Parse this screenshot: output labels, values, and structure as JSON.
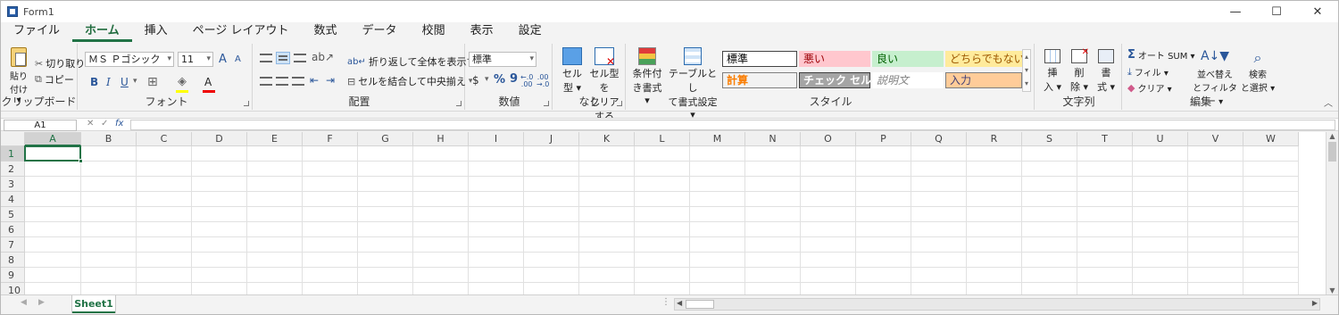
{
  "window": {
    "title": "Form1",
    "minimize": "—",
    "maximize": "☐",
    "close": "✕"
  },
  "tabs": [
    "ファイル",
    "ホーム",
    "挿入",
    "ページ レイアウト",
    "数式",
    "データ",
    "校閲",
    "表示",
    "設定"
  ],
  "active_tab": 1,
  "clipboard": {
    "paste": "貼り",
    "paste2": "付け ▾",
    "cut": "切り取り",
    "copy": "コピー",
    "label": "クリップボード"
  },
  "font": {
    "name": "ＭＳ Ｐゴシック",
    "size": "11",
    "grow": "A",
    "shrink": "A",
    "bold": "B",
    "italic": "I",
    "underline": "U",
    "color_letter": "A",
    "label": "フォント"
  },
  "alignment": {
    "wrap": "折り返して全体を表示する",
    "merge": "セルを結合して中央揃え",
    "label": "配置"
  },
  "number": {
    "format": "標準",
    "currency": "$",
    "percent": "%",
    "comma": "9",
    "inc": "←.0\n.00",
    "dec": ".00\n→.0",
    "label": "数値"
  },
  "cell_type": {
    "btn1a": "セル",
    "btn1b": "型 ▾",
    "btn2a": "セル型を",
    "btn2b": "クリアする",
    "label": "なし"
  },
  "styles_group": {
    "cond1": "条件付",
    "cond2": "き書式 ▾",
    "table1": "テーブルとし",
    "table2": "て書式設定 ▾",
    "label": "スタイル",
    "cells": [
      {
        "text": "標準",
        "bg": "#ffffff",
        "fg": "#000000",
        "border": "#444444"
      },
      {
        "text": "悪い",
        "bg": "#ffc7ce",
        "fg": "#9c0006",
        "border": "#ffc7ce"
      },
      {
        "text": "良い",
        "bg": "#c6efce",
        "fg": "#006100",
        "border": "#c6efce"
      },
      {
        "text": "どちらでもない",
        "bg": "#ffeb9c",
        "fg": "#9c5700",
        "border": "#ffeb9c"
      },
      {
        "text": "計算",
        "bg": "#f2f2f2",
        "fg": "#fa7d00",
        "border": "#7f7f7f"
      },
      {
        "text": "チェック セル",
        "bg": "#a5a5a5",
        "fg": "#ffffff",
        "border": "#3f3f3f"
      },
      {
        "text": "説明文",
        "bg": "#ffffff",
        "fg": "#7f7f7f",
        "border": "#ffffff"
      },
      {
        "text": "入力",
        "bg": "#ffcc99",
        "fg": "#3f3f76",
        "border": "#7f7f7f"
      }
    ]
  },
  "cells_group": {
    "insert1": "挿",
    "insert2": "入 ▾",
    "delete1": "削",
    "delete2": "除 ▾",
    "format1": "書",
    "format2": "式 ▾",
    "label": "文字列"
  },
  "editing": {
    "autosum": "オート SUM ▾",
    "fill": "フィル ▾",
    "clear": "クリア ▾",
    "sort1": "並べ替え",
    "sort2": "とフィルター ▾",
    "find1": "検索",
    "find2": "と選択 ▾",
    "label": "編集"
  },
  "formula_bar": {
    "namebox": "A1",
    "fx": "fx",
    "value": ""
  },
  "columns": [
    "A",
    "B",
    "C",
    "D",
    "E",
    "F",
    "G",
    "H",
    "I",
    "J",
    "K",
    "L",
    "M",
    "N",
    "O",
    "P",
    "Q",
    "R",
    "S",
    "T",
    "U",
    "V",
    "W"
  ],
  "rows": [
    "1",
    "2",
    "3",
    "4",
    "5",
    "6",
    "7",
    "8",
    "9",
    "10"
  ],
  "sheet": {
    "name": "Sheet1"
  },
  "accent": "#217346"
}
